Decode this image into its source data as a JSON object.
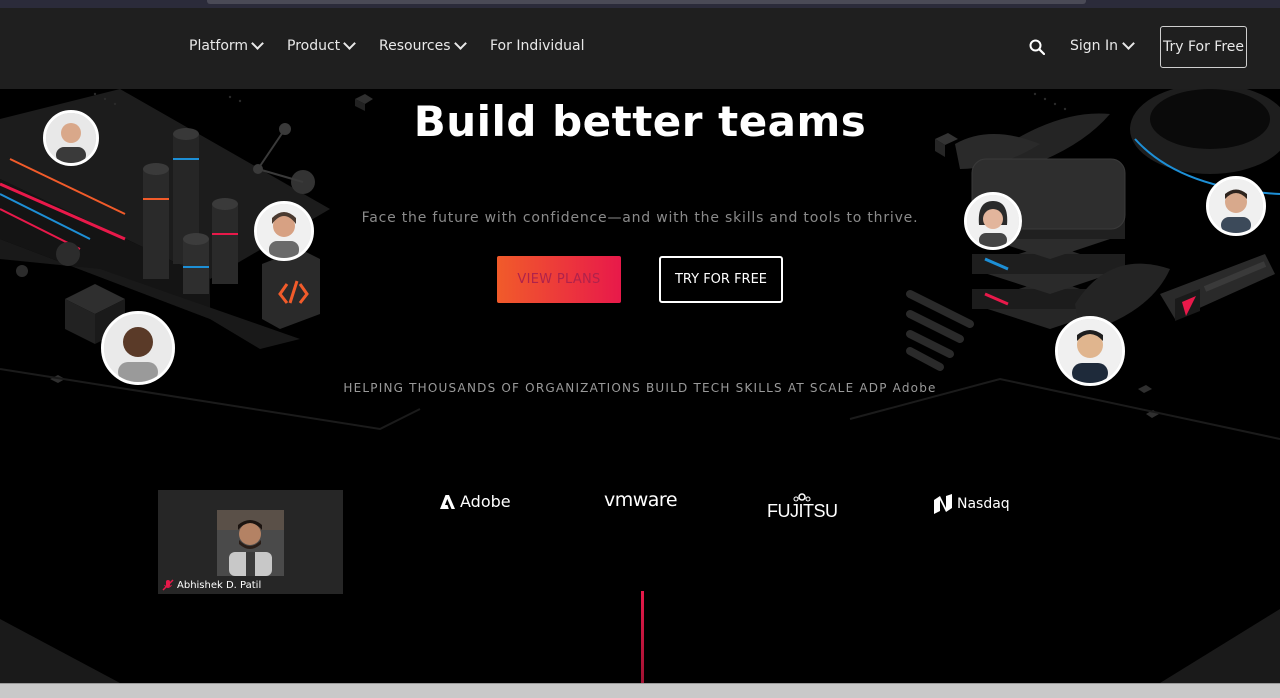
{
  "nav": {
    "items": [
      {
        "label": "Platform",
        "has_menu": true
      },
      {
        "label": "Product",
        "has_menu": true
      },
      {
        "label": "Resources",
        "has_menu": true
      },
      {
        "label": "For Individual",
        "has_menu": false
      }
    ],
    "sign_in": "Sign In",
    "try_free": "Try For Free"
  },
  "hero": {
    "title": "Build better teams",
    "subtitle": "Face the future with confidence—and with the skills and tools to thrive.",
    "view_plans": "VIEW PLANS",
    "try_free": "TRY FOR FREE",
    "helping": "HELPING THOUSANDS OF ORGANIZATIONS BUILD TECH SKILLS AT SCALE ADP Adobe"
  },
  "logos": [
    "Adobe",
    "vmware",
    "FUJITSU",
    "Nasdaq"
  ],
  "video": {
    "name": "Abhishek D. Patil"
  },
  "colors": {
    "accent_start": "#f15b2a",
    "accent_end": "#e8194a",
    "nav_bg": "#1f1f1f"
  }
}
